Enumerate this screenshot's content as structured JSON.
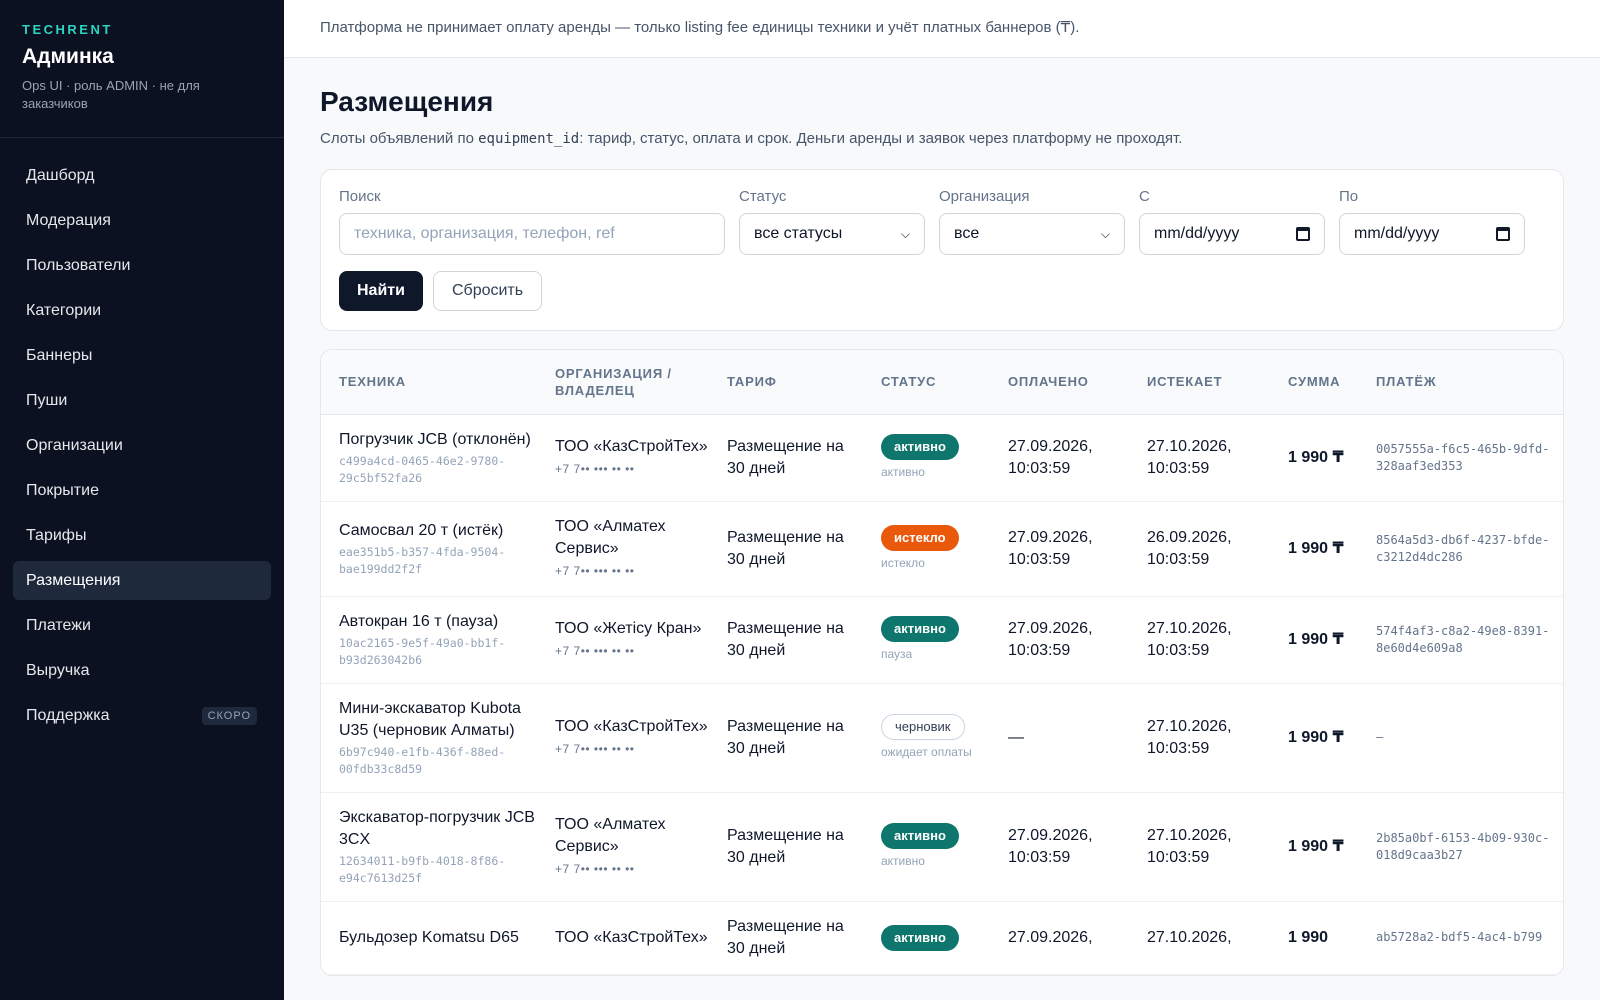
{
  "sidebar": {
    "brand_tag": "TECHRENT",
    "title": "Админка",
    "subtitle": "Ops UI · роль ADMIN · не для заказчиков",
    "items": [
      {
        "label": "Дашборд"
      },
      {
        "label": "Модерация"
      },
      {
        "label": "Пользователи"
      },
      {
        "label": "Категории"
      },
      {
        "label": "Баннеры"
      },
      {
        "label": "Пуши"
      },
      {
        "label": "Организации"
      },
      {
        "label": "Покрытие"
      },
      {
        "label": "Тарифы"
      },
      {
        "label": "Размещения",
        "active": true
      },
      {
        "label": "Платежи"
      },
      {
        "label": "Выручка"
      },
      {
        "label": "Поддержка",
        "badge": "СКОРО"
      }
    ]
  },
  "notice": "Платформа не принимает оплату аренды — только listing fee единицы техники и учёт платных баннеров (₸).",
  "page": {
    "title": "Размещения",
    "desc_before": "Слоты объявлений по ",
    "desc_code": "equipment_id",
    "desc_after": ": тариф, статус, оплата и срок. Деньги аренды и заявок через платформу не проходят."
  },
  "filters": {
    "search_label": "Поиск",
    "search_placeholder": "техника, организация, телефон, ref",
    "status_label": "Статус",
    "status_value": "все статусы",
    "org_label": "Организация",
    "org_value": "все",
    "from_label": "С",
    "from_value": "mm/dd/yyyy",
    "to_label": "По",
    "to_value": "mm/dd/yyyy",
    "find_button": "Найти",
    "reset_button": "Сбросить"
  },
  "table": {
    "headers": {
      "equipment": "ТЕХНИКА",
      "org": "ОРГАНИЗАЦИЯ / ВЛАДЕЛЕЦ",
      "tariff": "ТАРИФ",
      "status": "СТАТУС",
      "paid": "ОПЛАЧЕНО",
      "expires": "ИСТЕКАЕТ",
      "amount": "СУММА",
      "payment": "ПЛАТЁЖ"
    },
    "rows": [
      {
        "name": "Погрузчик JCB (отклонён)",
        "id": "c499a4cd-0465-46e2-9780-29c5bf52fa26",
        "org": "ТОО «КазСтройТех»",
        "phone": "+7 7•• ••• •• ••",
        "tariff": "Размещение на 30 дней",
        "status": "активно",
        "status_kind": "active",
        "substatus": "активно",
        "paid": "27.09.2026, 10:03:59",
        "expires": "27.10.2026, 10:03:59",
        "amount": "1 990 ₸",
        "payment": "0057555a-f6c5-465b-9dfd-328aaf3ed353"
      },
      {
        "name": "Самосвал 20 т (истёк)",
        "id": "eae351b5-b357-4fda-9504-bae199dd2f2f",
        "org": "ТОО «Алматех Сервис»",
        "phone": "+7 7•• ••• •• ••",
        "tariff": "Размещение на 30 дней",
        "status": "истекло",
        "status_kind": "expired",
        "substatus": "истекло",
        "paid": "27.09.2026, 10:03:59",
        "expires": "26.09.2026, 10:03:59",
        "amount": "1 990 ₸",
        "payment": "8564a5d3-db6f-4237-bfde-c3212d4dc286"
      },
      {
        "name": "Автокран 16 т (пауза)",
        "id": "10ac2165-9e5f-49a0-bb1f-b93d263042b6",
        "org": "ТОО «Жетісу Кран»",
        "phone": "+7 7•• ••• •• ••",
        "tariff": "Размещение на 30 дней",
        "status": "активно",
        "status_kind": "active",
        "substatus": "пауза",
        "paid": "27.09.2026, 10:03:59",
        "expires": "27.10.2026, 10:03:59",
        "amount": "1 990 ₸",
        "payment": "574f4af3-c8a2-49e8-8391-8e60d4e609a8"
      },
      {
        "name": "Мини-экскаватор Kubota U35 (черновик Алматы)",
        "id": "6b97c940-e1fb-436f-88ed-00fdb33c8d59",
        "org": "ТОО «КазСтройТех»",
        "phone": "+7 7•• ••• •• ••",
        "tariff": "Размещение на 30 дней",
        "status": "черновик",
        "status_kind": "draft",
        "substatus": "ожидает оплаты",
        "paid": "—",
        "expires": "27.10.2026, 10:03:59",
        "amount": "1 990 ₸",
        "payment": "–"
      },
      {
        "name": "Экскаватор-погрузчик JCB 3CX",
        "id": "12634011-b9fb-4018-8f86-e94c7613d25f",
        "org": "ТОО «Алматех Сервис»",
        "phone": "+7 7•• ••• •• ••",
        "tariff": "Размещение на 30 дней",
        "status": "активно",
        "status_kind": "active",
        "substatus": "активно",
        "paid": "27.09.2026, 10:03:59",
        "expires": "27.10.2026, 10:03:59",
        "amount": "1 990 ₸",
        "payment": "2b85a0bf-6153-4b09-930c-018d9caa3b27"
      },
      {
        "name": "Бульдозер Komatsu D65",
        "id": "",
        "org": "ТОО «КазСтройТех»",
        "phone": "",
        "tariff": "Размещение на 30 дней",
        "status": "активно",
        "status_kind": "active",
        "substatus": "",
        "paid": "27.09.2026,",
        "expires": "27.10.2026,",
        "amount": "1 990",
        "payment": "ab5728a2-bdf5-4ac4-b799"
      }
    ]
  }
}
